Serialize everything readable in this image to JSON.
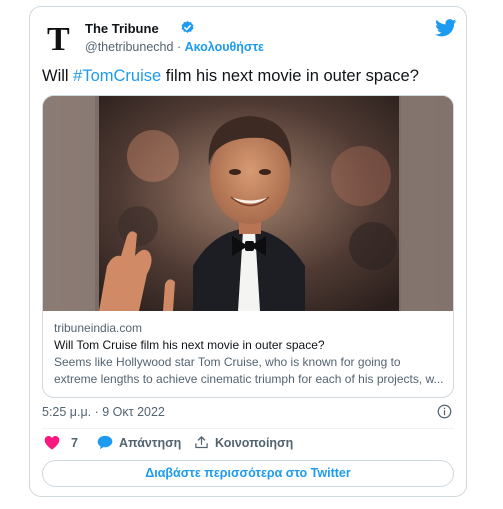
{
  "author": {
    "name": "The Tribune",
    "handle": "@thetribunechd",
    "separator": "·",
    "follow_label": "Ακολουθήστε",
    "logo_glyph": "T"
  },
  "tweet": {
    "text_before": "Will ",
    "hashtag": "#TomCruise",
    "text_after": " film his next movie in outer space?"
  },
  "link_card": {
    "domain": "tribuneindia.com",
    "title": "Will Tom Cruise film his next movie in outer space?",
    "description_line1": "Seems like Hollywood star Tom Cruise, who is known for going to",
    "description_line2": "extreme lengths to achieve cinematic triumph for each of his projects, w..."
  },
  "timestamp": "5:25 μ.μ. · 9 Οκτ 2022",
  "actions": {
    "like_count": "7",
    "reply_label": "Απάντηση",
    "share_label": "Κοινοποίηση"
  },
  "read_more_label": "Διαβάστε περισσότερα στο Twitter",
  "colors": {
    "accent": "#1d9bf0",
    "like": "#f91880",
    "text_primary": "#0f1419",
    "text_secondary": "#536471",
    "border": "#cfd9de"
  }
}
